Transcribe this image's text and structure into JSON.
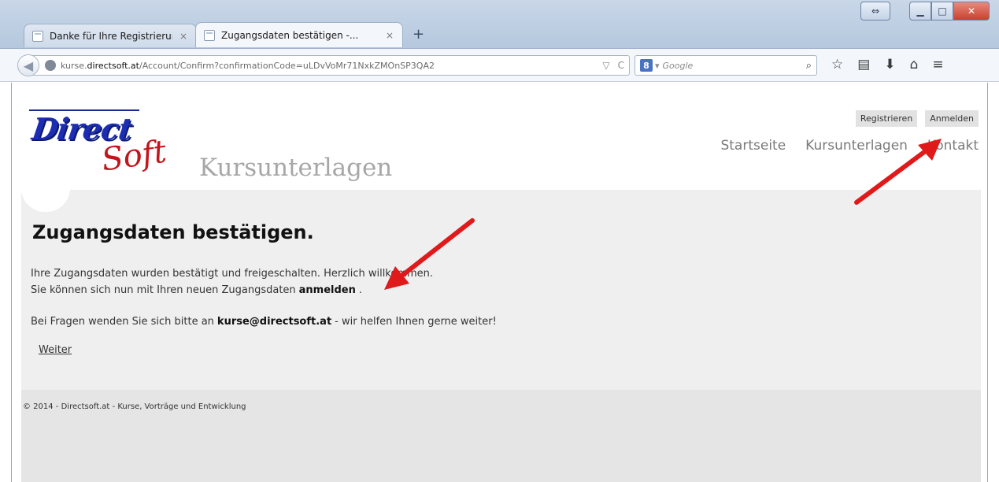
{
  "browser": {
    "tabs": [
      {
        "title": "Danke für Ihre Registrierun...",
        "close": "×"
      },
      {
        "title": "Zugangsdaten bestätigen -...",
        "close": "×"
      }
    ],
    "new_tab": "+",
    "url_prefix": "kurse.",
    "url_domain": "directsoft.at",
    "url_path": "/Account/Confirm?confirmationCode=uLDvVoMr71NxkZMOnSP3QA2",
    "search_placeholder": "Google",
    "search_engine_badge": "8"
  },
  "site": {
    "logo_direct": "Direct",
    "logo_soft": "Soft",
    "subtitle": "Kursunterlagen",
    "top_links": {
      "register": "Registrieren",
      "login": "Anmelden"
    },
    "nav": [
      "Startseite",
      "Kursunterlagen",
      "Kontakt"
    ]
  },
  "content": {
    "title": "Zugangsdaten bestätigen.",
    "line1": "Ihre Zugangsdaten wurden bestätigt und freigeschalten. Herzlich willkommen.",
    "line2_before": "Sie können sich nun mit Ihren neuen Zugangsdaten",
    "line2_link": "anmelden",
    "line2_after": ".",
    "contact_before": "Bei Fragen wenden Sie sich bitte an",
    "contact_email": "kurse@directsoft.at",
    "contact_after": "- wir helfen Ihnen gerne weiter!",
    "weiter": "Weiter"
  },
  "footer": {
    "text": "© 2014 - Directsoft.at - Kurse, Vorträge und Entwicklung"
  },
  "colors": {
    "annotation_arrow": "#e0191b",
    "logo_blue": "#1c2db3",
    "logo_red": "#c4141c"
  }
}
